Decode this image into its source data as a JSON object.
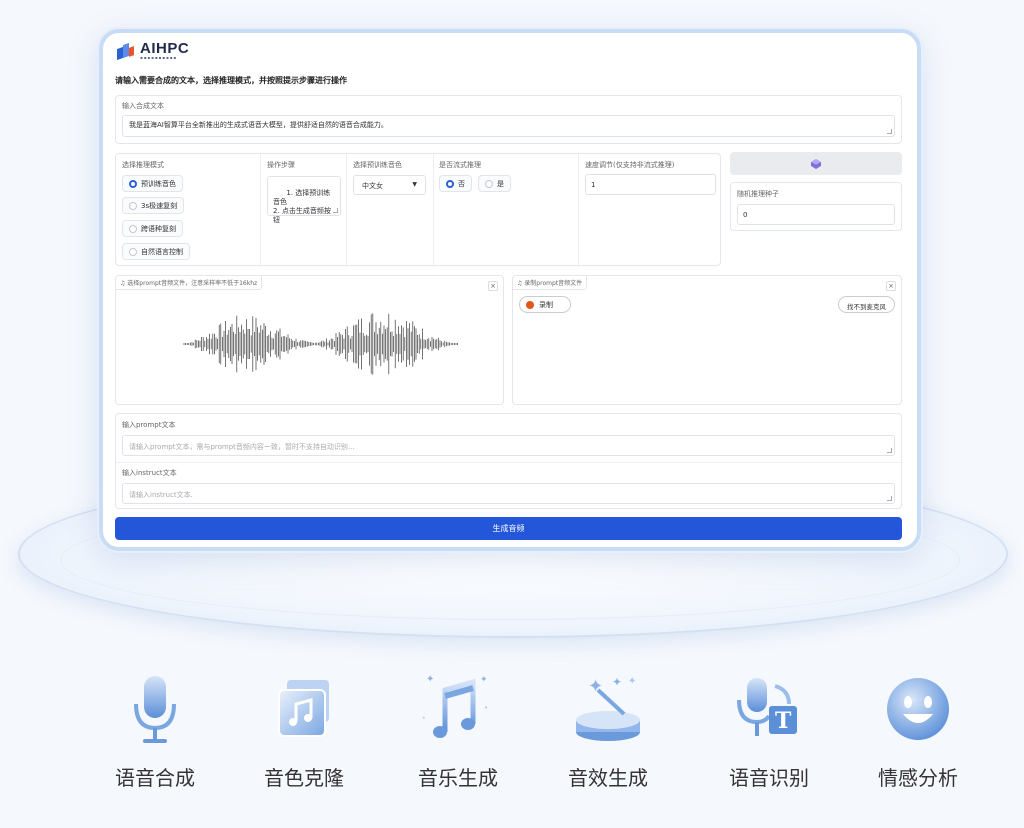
{
  "brand": {
    "name": "AIHPC"
  },
  "instruction": "请输入需要合成的文本，选择推理模式，并按照提示步骤进行操作",
  "synthesis_text": {
    "label": "输入合成文本",
    "value": "我是蓝海AI智算平台全新推出的生成式语音大模型，提供舒适自然的语音合成能力。"
  },
  "inference_mode": {
    "label": "选择推理模式",
    "options": [
      "预训练音色",
      "3s极速复刻",
      "跨语种复刻",
      "自然语言控制"
    ],
    "selected": "预训练音色"
  },
  "steps": {
    "label": "操作步骤",
    "value": "1. 选择预训练音色\n2. 点击生成音频按钮"
  },
  "voice": {
    "label": "选择预训练音色",
    "value": "中文女"
  },
  "stream": {
    "label": "是否流式推理",
    "options": [
      "否",
      "是"
    ],
    "selected": "否"
  },
  "speed": {
    "label": "速度调节(仅支持非流式推理)",
    "value": "1"
  },
  "seed": {
    "label": "随机推理种子",
    "value": "0",
    "dice_icon": "dice-icon"
  },
  "prompt_audio": {
    "label": "选择prompt音频文件，注意采样率不低于16khz"
  },
  "record_audio": {
    "label": "录制prompt音频文件",
    "record_button": "录制",
    "mic_button": "找不到麦克风"
  },
  "prompt_text": {
    "label": "输入prompt文本",
    "placeholder": "请输入prompt文本，需与prompt音频内容一致，暂时不支持自动识别..."
  },
  "instruct_text": {
    "label": "输入instruct文本",
    "placeholder": "请输入instruct文本."
  },
  "generate_button": "生成音频",
  "features": [
    {
      "name": "语音合成",
      "icon": "microphone-icon"
    },
    {
      "name": "音色克隆",
      "icon": "music-note-album-icon"
    },
    {
      "name": "音乐生成",
      "icon": "music-notes-sparkle-icon"
    },
    {
      "name": "音效生成",
      "icon": "magic-wand-stage-icon"
    },
    {
      "name": "语音识别",
      "icon": "microphone-text-icon"
    },
    {
      "name": "情感分析",
      "icon": "smiley-face-icon"
    }
  ],
  "colors": {
    "primary": "#2356d8",
    "record": "#e3561b",
    "icon_gradient_top": "#bcd3f3",
    "icon_gradient_bottom": "#5b8fd8"
  }
}
